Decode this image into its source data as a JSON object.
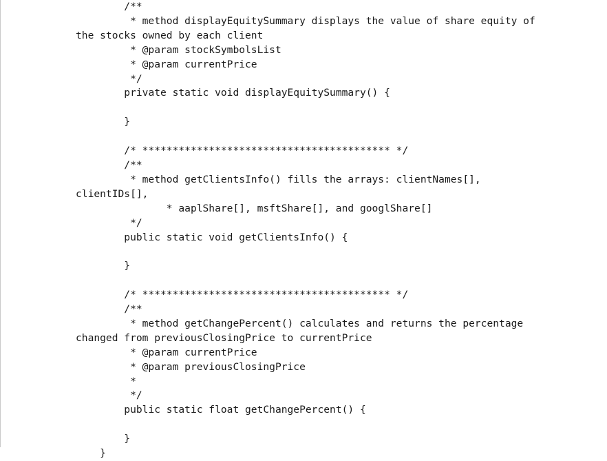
{
  "document": {
    "kind": "source-code-listing",
    "language": "java",
    "background_color": "#ffffff",
    "text_color": "#1a1a1a",
    "left_rule_color": "#c9c9c9",
    "lines": [
      "        /**",
      "         * method displayEquitySummary displays the value of share equity of the stocks owned by each client",
      "         * @param stockSymbolsList",
      "         * @param currentPrice",
      "         */",
      "        private static void displayEquitySummary() {",
      "",
      "        }",
      "",
      "        /* ***************************************** */",
      "        /**",
      "         * method getClientsInfo() fills the arrays: clientNames[], clientIDs[],",
      "               * aaplShare[], msftShare[], and googlShare[]",
      "         */",
      "        public static void getClientsInfo() {",
      "",
      "        }",
      "",
      "        /* ***************************************** */",
      "        /**",
      "         * method getChangePercent() calculates and returns the percentage changed from previousClosingPrice to currentPrice",
      "         * @param currentPrice",
      "         * @param previousClosingPrice",
      "         *",
      "         */",
      "        public static float getChangePercent() {",
      "",
      "        }",
      "    }"
    ],
    "symbols": {
      "methods": [
        "displayEquitySummary()",
        "getClientsInfo()",
        "getChangePercent()"
      ],
      "params": [
        "stockSymbolsList",
        "currentPrice",
        "previousClosingPrice"
      ],
      "arrays": [
        "clientNames[]",
        "clientIDs[]",
        "aaplShare[]",
        "msftShare[]",
        "googlShare[]"
      ],
      "modifiers": [
        "private",
        "public",
        "static"
      ],
      "return_types": [
        "void",
        "float"
      ]
    },
    "separator_comment": "/* ***************************************** */"
  }
}
